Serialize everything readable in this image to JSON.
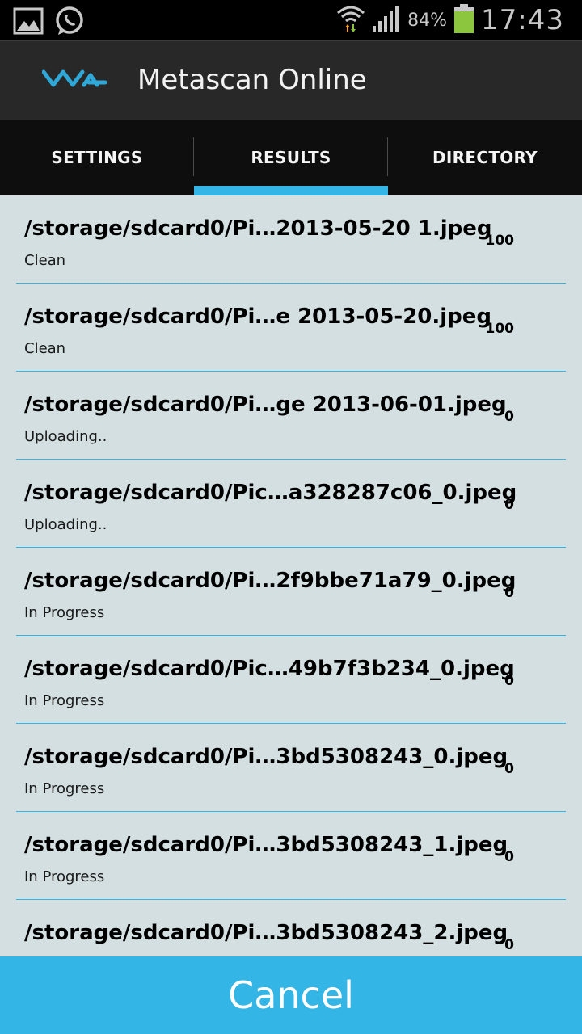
{
  "status_bar": {
    "battery_pct": "84%",
    "time": "17:43",
    "icons": [
      "gallery-icon",
      "whatsapp-icon",
      "wifi-icon",
      "signal-icon",
      "battery-icon"
    ]
  },
  "app": {
    "title": "Metascan Online"
  },
  "tabs": [
    {
      "label": "SETTINGS",
      "selected": false
    },
    {
      "label": "RESULTS",
      "selected": true
    },
    {
      "label": "DIRECTORY",
      "selected": false
    }
  ],
  "results": [
    {
      "path": "/storage/sdcard0/Pi…2013-05-20 1.jpeg",
      "status": "Clean",
      "score": "100"
    },
    {
      "path": "/storage/sdcard0/Pi…e 2013-05-20.jpeg",
      "status": "Clean",
      "score": "100"
    },
    {
      "path": "/storage/sdcard0/Pi…ge 2013-06-01.jpeg",
      "status": "Uploading..",
      "score": "0"
    },
    {
      "path": "/storage/sdcard0/Pic…a328287c06_0.jpeg",
      "status": "Uploading..",
      "score": "0"
    },
    {
      "path": "/storage/sdcard0/Pi…2f9bbe71a79_0.jpeg",
      "status": "In Progress",
      "score": "0"
    },
    {
      "path": "/storage/sdcard0/Pic…49b7f3b234_0.jpeg",
      "status": "In Progress",
      "score": "0"
    },
    {
      "path": "/storage/sdcard0/Pi…3bd5308243_0.jpeg",
      "status": "In Progress",
      "score": "0"
    },
    {
      "path": "/storage/sdcard0/Pi…3bd5308243_1.jpeg",
      "status": "In Progress",
      "score": "0"
    },
    {
      "path": "/storage/sdcard0/Pi…3bd5308243_2.jpeg",
      "status": "",
      "score": "0"
    }
  ],
  "cancel_label": "Cancel",
  "colors": {
    "accent": "#33b5e5",
    "list_bg": "#d3dfe0",
    "battery": "#8cc63f"
  }
}
